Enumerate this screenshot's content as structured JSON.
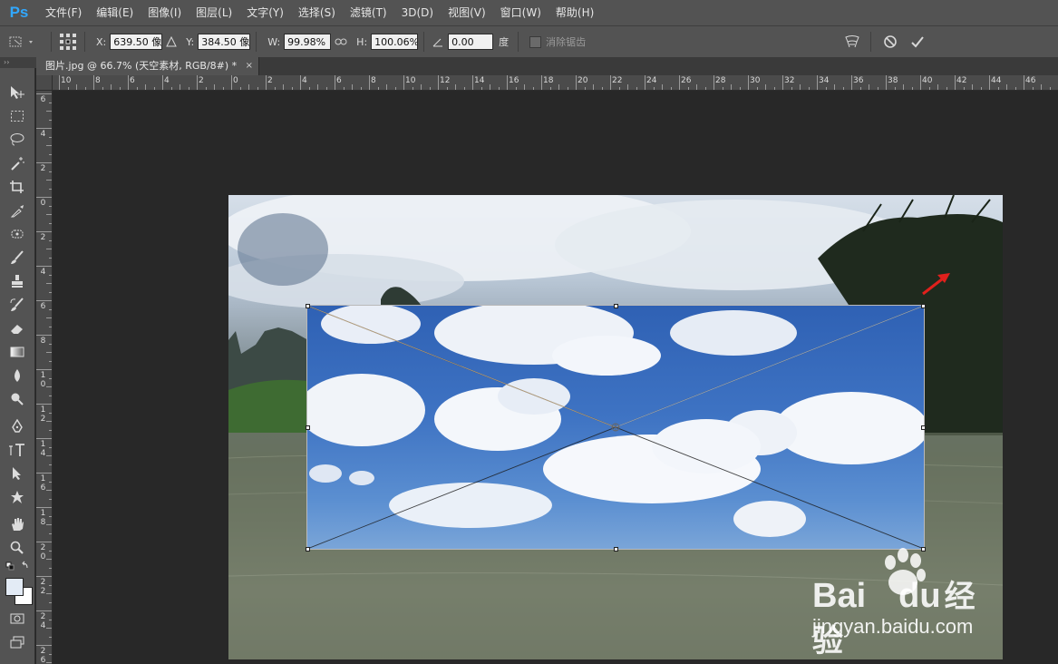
{
  "app": {
    "logo": "Ps"
  },
  "menu": [
    "文件(F)",
    "编辑(E)",
    "图像(I)",
    "图层(L)",
    "文字(Y)",
    "选择(S)",
    "滤镜(T)",
    "3D(D)",
    "视图(V)",
    "窗口(W)",
    "帮助(H)"
  ],
  "options": {
    "x_label": "X:",
    "x_value": "639.50 像素",
    "y_label": "Y:",
    "y_value": "384.50 像素",
    "w_label": "W:",
    "w_value": "99.98%",
    "h_label": "H:",
    "h_value": "100.06%",
    "angle_value": "0.00",
    "angle_unit": "度",
    "antialias_label": "消除锯齿",
    "antialias_checked": false
  },
  "document": {
    "tab_title": "图片.jpg @ 66.7% (天空素材, RGB/8#) *",
    "close_glyph": "×"
  },
  "ruler_h": [
    "10",
    "8",
    "6",
    "4",
    "2",
    "0",
    "2",
    "4",
    "6",
    "8",
    "10",
    "12",
    "14",
    "16",
    "18",
    "20",
    "22",
    "24",
    "26",
    "28",
    "30",
    "32",
    "34",
    "36",
    "38",
    "40",
    "42",
    "44",
    "46"
  ],
  "ruler_v": [
    "6",
    "4",
    "2",
    "0",
    "2",
    "4",
    "6",
    "8",
    "10",
    "12",
    "14",
    "16",
    "18",
    "20",
    "22",
    "24",
    "26"
  ],
  "watermark": {
    "brand": "Bai",
    "brand2": "du",
    "cn": "经验",
    "url": "jingyan.baidu.com"
  },
  "colors": {
    "accent": "#31a8ff",
    "arrow": "#e0201c"
  },
  "icons": [
    "move-tool-icon",
    "marquee-icon",
    "lasso-icon",
    "magic-wand-icon",
    "crop-icon",
    "eyedropper-icon",
    "healing-brush-icon",
    "brush-icon",
    "clone-stamp-icon",
    "history-brush-icon",
    "eraser-icon",
    "gradient-icon",
    "blur-icon",
    "dodge-icon",
    "pen-icon",
    "type-icon",
    "path-selection-icon",
    "shape-icon",
    "hand-icon",
    "zoom-icon"
  ]
}
